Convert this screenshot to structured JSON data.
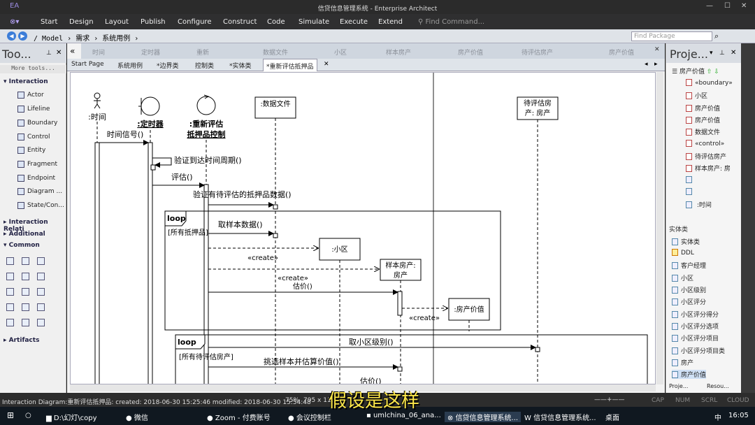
{
  "window": {
    "title": "信贷信息管理系统 - Enterprise Architect",
    "logo": "EA"
  },
  "menu": [
    "Start",
    "Design",
    "Layout",
    "Publish",
    "Configure",
    "Construct",
    "Code",
    "Simulate",
    "Execute",
    "Extend"
  ],
  "find_command": "Find Command...",
  "breadcrumb": "/ Model › 需求 › 系统用例 ›",
  "find_package": "Find Package",
  "toolbox": {
    "title": "Too...",
    "more": "More tools...",
    "interaction": "Interaction",
    "items": [
      "Actor",
      "Lifeline",
      "Boundary",
      "Control",
      "Entity",
      "Fragment",
      "Endpoint",
      "Diagram ...",
      "State/Con..."
    ],
    "sections": [
      "Interaction Relati",
      "Additional",
      "Common",
      "Artifacts"
    ]
  },
  "ghost_header": [
    "时间",
    "定时器",
    "重新",
    "数据文件",
    "小区",
    "样本房产",
    "房产价值",
    "待评估房产",
    "房产价值"
  ],
  "tabs": [
    "Start Page",
    "系统用例",
    "*边界类",
    "控制类",
    "*实体类",
    "*重新评估抵押品"
  ],
  "diagram": {
    "lifelines": [
      ":时间",
      ":定时器",
      ":重新评估",
      "抵押品控制",
      ":数据文件",
      "待评估房",
      "产: 房产",
      ":小区",
      "样本房产:",
      "房产",
      ":房产价值"
    ],
    "messages": [
      "时间信号()",
      "验证到达时间周期()",
      "评估()",
      "验证有待评估的抵押品数据()",
      "取样本数据()",
      "«create»",
      "«create»",
      "估价()",
      "«create»",
      "取小区级别()",
      "挑选样本并估算价值()",
      "估价()"
    ],
    "fragments": [
      {
        "op": "loop",
        "guard": "[所有抵押品]"
      },
      {
        "op": "loop",
        "guard": "[所有待评估房产]"
      }
    ]
  },
  "project": {
    "title": "Proje...",
    "items": [
      "«boundary»",
      "小区",
      "房产价值",
      "房产价值",
      "数据文件",
      "«control»",
      "待评估房产",
      "样本房产: 房",
      "",
      "",
      " :时间"
    ],
    "section": "实体类",
    "items2": [
      "实体类",
      "DDL",
      "客户经理",
      "小区",
      "小区级别",
      "小区评分",
      "小区评分得分",
      "小区评分选项",
      "小区评分项目",
      "小区评分项目类",
      "房产",
      "房产价值"
    ],
    "tabs": [
      "Proje...",
      "Resou..."
    ]
  },
  "status": {
    "diagram": "Interaction Diagram:重新评估抵押品:  created: 2018-06-30 15:25:46  modified: 2018-06-30 15:54:48",
    "zoom": "75%",
    "size": "795 x 113",
    "flags": [
      "CAP",
      "NUM",
      "SCRL",
      "CLOUD"
    ]
  },
  "subtitle": "假设是这样",
  "taskbar": {
    "items": [
      "D:\\幻灯\\copy",
      "微信",
      "Zoom - 付费账号",
      "会议控制栏",
      "umlchina_06_ana...",
      "信贷信息管理系统...",
      "信贷信息管理系统..."
    ],
    "desktop": "桌面",
    "ime": "中",
    "clock": "16:05"
  }
}
